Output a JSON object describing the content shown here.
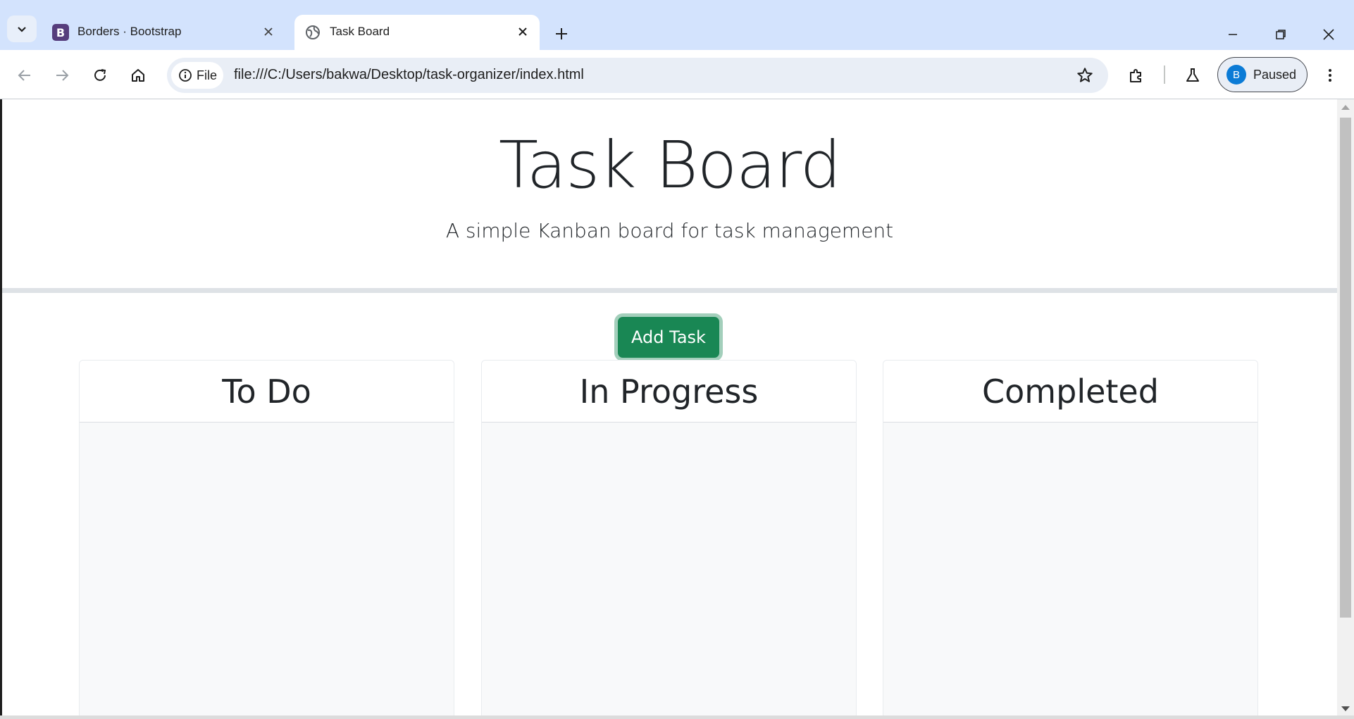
{
  "browser": {
    "tabs": [
      {
        "title": "Borders · Bootstrap",
        "favicon": "bootstrap-icon",
        "active": false
      },
      {
        "title": "Task Board",
        "favicon": "globe-icon",
        "active": true
      }
    ],
    "address": {
      "scheme_chip": "File",
      "url": "file:///C:/Users/bakwa/Desktop/task-organizer/index.html"
    },
    "profile": {
      "initial": "B",
      "status": "Paused"
    }
  },
  "page": {
    "title": "Task Board",
    "subtitle": "A simple Kanban board for task management",
    "add_button": "Add Task",
    "lanes": [
      {
        "title": "To Do",
        "tasks": []
      },
      {
        "title": "In Progress",
        "tasks": []
      },
      {
        "title": "Completed",
        "tasks": []
      }
    ]
  },
  "colors": {
    "chrome_bg": "#d3e3fd",
    "primary_green": "#198754",
    "lane_bg": "#f8f9fa",
    "text": "#212529"
  }
}
